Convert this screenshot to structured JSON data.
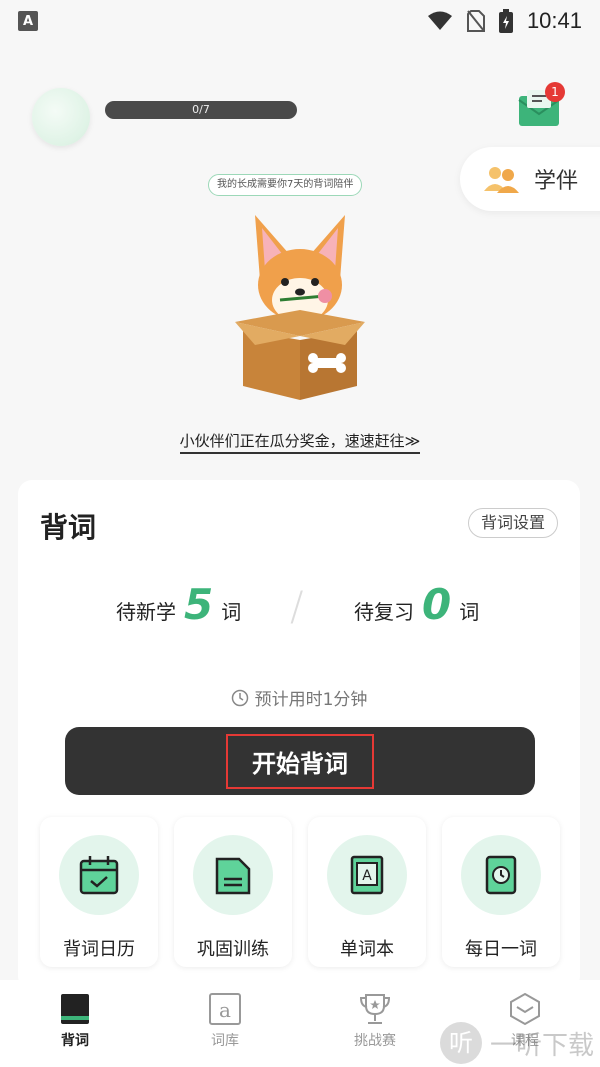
{
  "status_bar": {
    "app_badge": "A",
    "time": "10:41"
  },
  "profile": {
    "progress_text": "0/7",
    "progress_fraction": 0
  },
  "mail": {
    "badge_count": "1"
  },
  "companion": {
    "label": "学伴"
  },
  "mascot": {
    "bubble_text": "我的长成需要你7天的背词陪伴"
  },
  "promo": {
    "text": "小伙伴们正在瓜分奖金，速速赶往≫"
  },
  "card": {
    "title": "背词",
    "settings_label": "背词设置",
    "new_label": "待新学",
    "new_count": "5",
    "review_label": "待复习",
    "review_count": "0",
    "unit": "词",
    "eta": "预计用时1分钟",
    "start_label": "开始背词"
  },
  "features": [
    {
      "label": "背词日历",
      "icon": "calendar-icon"
    },
    {
      "label": "巩固训练",
      "icon": "folder-icon"
    },
    {
      "label": "单词本",
      "icon": "wordbook-icon"
    },
    {
      "label": "每日一词",
      "icon": "daily-clock-icon"
    }
  ],
  "nav": [
    {
      "label": "背词",
      "icon": "book-icon",
      "active": true
    },
    {
      "label": "词库",
      "icon": "letter-a-icon",
      "active": false
    },
    {
      "label": "挑战赛",
      "icon": "trophy-icon",
      "active": false
    },
    {
      "label": "课程",
      "icon": "course-icon",
      "active": false
    }
  ],
  "watermark": {
    "glyph": "听",
    "text": "一听下载"
  },
  "colors": {
    "accent": "#3db47a",
    "button": "#333333",
    "highlight_border": "#e53935"
  }
}
